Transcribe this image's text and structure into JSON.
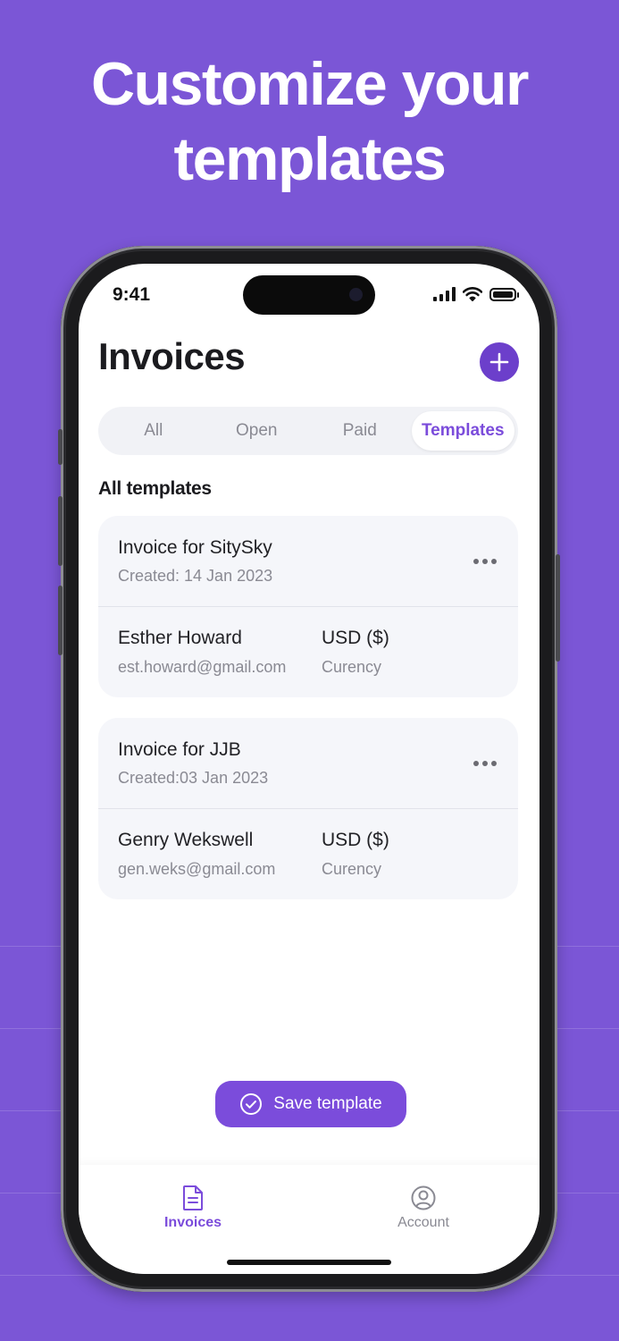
{
  "headline": {
    "line1": "Customize your",
    "line2": "templates"
  },
  "status_bar": {
    "time": "9:41"
  },
  "header": {
    "title": "Invoices",
    "add_icon": "plus-icon"
  },
  "tabs": [
    {
      "label": "All",
      "active": false
    },
    {
      "label": "Open",
      "active": false
    },
    {
      "label": "Paid",
      "active": false
    },
    {
      "label": "Templates",
      "active": true
    }
  ],
  "section_label": "All templates",
  "templates": [
    {
      "title": "Invoice for SitySky",
      "created": "Created: 14 Jan 2023",
      "client_name": "Esther Howard",
      "client_email": "est.howard@gmail.com",
      "currency_value": "USD ($)",
      "currency_label": "Curency"
    },
    {
      "title": "Invoice for JJB",
      "created": "Created:03 Jan 2023",
      "client_name": "Genry Wekswell",
      "client_email": "gen.weks@gmail.com",
      "currency_value": "USD ($)",
      "currency_label": "Curency"
    }
  ],
  "save_button": {
    "label": "Save template",
    "icon": "check-circle-icon"
  },
  "bottom_nav": [
    {
      "label": "Invoices",
      "icon": "document-icon",
      "active": true
    },
    {
      "label": "Account",
      "icon": "user-icon",
      "active": false
    }
  ],
  "colors": {
    "background": "#7B56D6",
    "accent": "#7B4CDB",
    "accent_dark": "#6C3FCB"
  }
}
